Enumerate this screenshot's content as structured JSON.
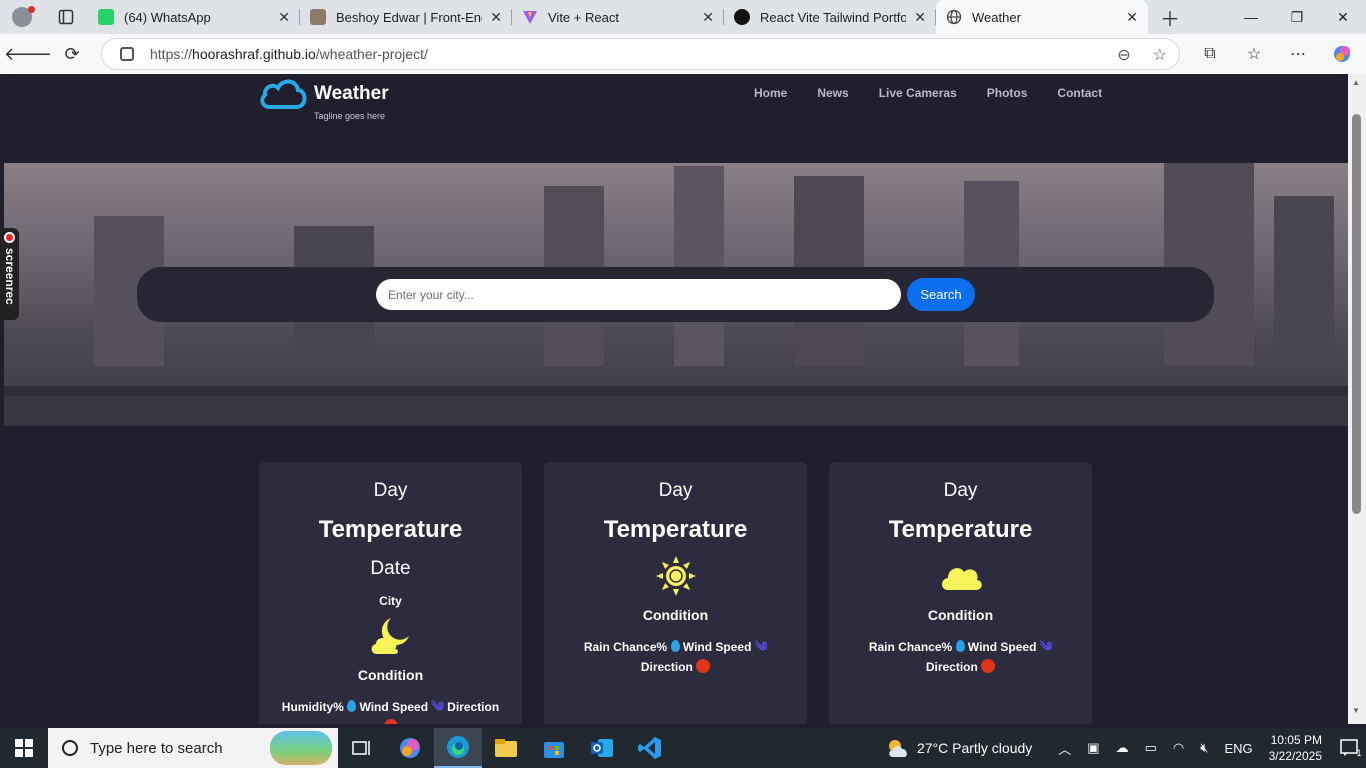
{
  "browser": {
    "tabs": [
      {
        "title": "(64) WhatsApp",
        "favicon": "whatsapp-icon",
        "color": "#25d366"
      },
      {
        "title": "Beshoy Edwar | Front-End W",
        "favicon": "site-icon",
        "color": "#8c7a68"
      },
      {
        "title": "Vite + React",
        "favicon": "vite-icon",
        "color": "#9b59f6"
      },
      {
        "title": "React Vite Tailwind Portfolio",
        "favicon": "github-icon",
        "color": "#111111"
      },
      {
        "title": "Weather",
        "favicon": "globe-icon",
        "color": "#444444"
      }
    ],
    "url_prefix": "https://",
    "url_host": "hoorashraf.github.io",
    "url_path": "/wheather-project/"
  },
  "site": {
    "logo_title": "Weather",
    "logo_tagline": "Tagline goes here",
    "nav": [
      "Home",
      "News",
      "Live Cameras",
      "Photos",
      "Contact"
    ]
  },
  "search": {
    "placeholder": "Enter your city...",
    "button_label": "Search"
  },
  "cards": [
    {
      "day": "Day",
      "temperature": "Temperature",
      "date": "Date",
      "city": "City",
      "icon": "moon-cloud-icon",
      "condition": "Condition",
      "stats_a": "Humidity%",
      "stats_b": "Wind Speed",
      "stats_c": "Direction"
    },
    {
      "day": "Day",
      "temperature": "Temperature",
      "icon": "sun-icon",
      "condition": "Condition",
      "stats_a": "Rain Chance%",
      "stats_b": "Wind Speed",
      "stats_c": "Direction"
    },
    {
      "day": "Day",
      "temperature": "Temperature",
      "icon": "cloud-icon",
      "condition": "Condition",
      "stats_a": "Rain Chance%",
      "stats_b": "Wind Speed",
      "stats_c": "Direction"
    }
  ],
  "overlay": {
    "label": "screenrec"
  },
  "taskbar": {
    "search_placeholder": "Type here to search",
    "weather": "27°C  Partly cloudy",
    "language": "ENG",
    "time": "10:05 PM",
    "date": "3/22/2025",
    "notifications": "1"
  },
  "colors": {
    "accent": "#0b6ff0",
    "card_bg": "#2c2c3e",
    "page_bg": "#1f1f2e",
    "icon_yellow": "#f7f35a"
  }
}
